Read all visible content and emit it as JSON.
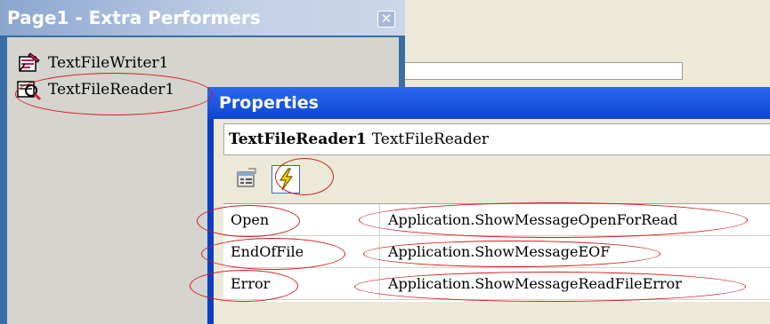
{
  "extra_performers": {
    "title": "Page1 - Extra Performers",
    "close_label": "✕",
    "items": [
      {
        "label": "TextFileWriter1",
        "icon": "text-file-writer-icon"
      },
      {
        "label": "TextFileReader1",
        "icon": "text-file-reader-icon"
      }
    ]
  },
  "properties": {
    "title": "Properties",
    "object_name": "TextFileReader1",
    "object_type": "TextFileReader",
    "toolbar": {
      "properties_icon": "properties-icon",
      "events_icon": "lightning-icon"
    },
    "events": [
      {
        "name": "Open",
        "value": "Application.ShowMessageOpenForRead"
      },
      {
        "name": "EndOfFile",
        "value": "Application.ShowMessageEOF"
      },
      {
        "name": "Error",
        "value": "Application.ShowMessageReadFileError"
      }
    ]
  },
  "colors": {
    "annotation": "#d21b1b",
    "properties_title": "#0d45d2",
    "window_bg": "#ece9d8"
  }
}
